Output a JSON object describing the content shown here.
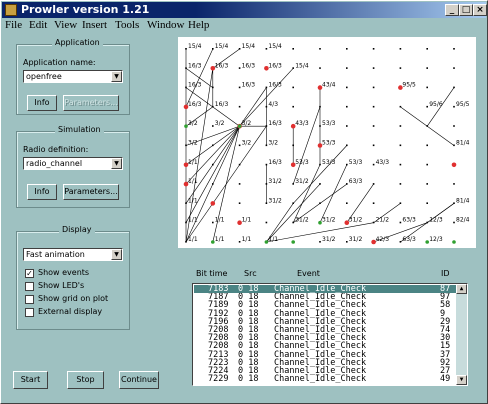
{
  "window": {
    "title": "Prowler version 1.21",
    "minimize": "_",
    "maximize": "□",
    "close": "×"
  },
  "menu": [
    "File",
    "Edit",
    "View",
    "Insert",
    "Tools",
    "Window",
    "Help"
  ],
  "application": {
    "group_title": "Application",
    "name_label": "Application name:",
    "name_value": "openfree",
    "info_button": "Info",
    "parameters_button": "Parameters..."
  },
  "simulation": {
    "group_title": "Simulation",
    "radio_label": "Radio definition:",
    "radio_value": "radio_channel",
    "info_button": "Info",
    "parameters_button": "Parameters..."
  },
  "display": {
    "group_title": "Display",
    "mode_value": "Fast animation",
    "checkboxes": [
      {
        "label": "Show events",
        "checked": true
      },
      {
        "label": "Show LED's",
        "checked": false
      },
      {
        "label": "Show grid on plot",
        "checked": false
      },
      {
        "label": "External display",
        "checked": false
      }
    ]
  },
  "buttons": {
    "start": "Start",
    "stop": "Stop",
    "continue": "Continue"
  },
  "plot": {
    "node_labels": [
      {
        "t": "15/4",
        "c": 0,
        "r": 0
      },
      {
        "t": "15/4",
        "c": 1,
        "r": 0
      },
      {
        "t": "15/4",
        "c": 2,
        "r": 0
      },
      {
        "t": "15/4",
        "c": 3,
        "r": 0
      },
      {
        "t": "16/3",
        "c": 0,
        "r": 1
      },
      {
        "t": "16/3",
        "c": 1,
        "r": 1
      },
      {
        "t": "16/3",
        "c": 2,
        "r": 1
      },
      {
        "t": "16/3",
        "c": 3,
        "r": 1
      },
      {
        "t": "15/4",
        "c": 4,
        "r": 1
      },
      {
        "t": "16/3",
        "c": 0,
        "r": 2
      },
      {
        "t": "16/3",
        "c": 2,
        "r": 2
      },
      {
        "t": "16/3",
        "c": 3,
        "r": 2
      },
      {
        "t": "43/4",
        "c": 5,
        "r": 2
      },
      {
        "t": "95/5",
        "c": 8,
        "r": 2
      },
      {
        "t": "16/3",
        "c": 0,
        "r": 3
      },
      {
        "t": "16/3",
        "c": 1,
        "r": 3
      },
      {
        "t": "4/3",
        "c": 3,
        "r": 3
      },
      {
        "t": "95/6",
        "c": 9,
        "r": 3
      },
      {
        "t": "95/5",
        "c": 10,
        "r": 3
      },
      {
        "t": "3/2",
        "c": 0,
        "r": 4
      },
      {
        "t": "3/2",
        "c": 1,
        "r": 4
      },
      {
        "t": "3/2",
        "c": 2,
        "r": 4
      },
      {
        "t": "16/3",
        "c": 3,
        "r": 4
      },
      {
        "t": "43/3",
        "c": 4,
        "r": 4
      },
      {
        "t": "53/3",
        "c": 5,
        "r": 4
      },
      {
        "t": "3/2",
        "c": 0,
        "r": 5
      },
      {
        "t": "3/2",
        "c": 2,
        "r": 5
      },
      {
        "t": "3/2",
        "c": 3,
        "r": 5
      },
      {
        "t": "53/3",
        "c": 5,
        "r": 5
      },
      {
        "t": "81/4",
        "c": 10,
        "r": 5
      },
      {
        "t": "1/1",
        "c": 0,
        "r": 6
      },
      {
        "t": "16/3",
        "c": 3,
        "r": 6
      },
      {
        "t": "53/3",
        "c": 4,
        "r": 6
      },
      {
        "t": "53/3",
        "c": 5,
        "r": 6
      },
      {
        "t": "53/3",
        "c": 6,
        "r": 6
      },
      {
        "t": "43/3",
        "c": 7,
        "r": 6
      },
      {
        "t": "1/1",
        "c": 0,
        "r": 7
      },
      {
        "t": "31/2",
        "c": 3,
        "r": 7
      },
      {
        "t": "31/2",
        "c": 4,
        "r": 7
      },
      {
        "t": "63/3",
        "c": 6,
        "r": 7
      },
      {
        "t": "1/1",
        "c": 0,
        "r": 8
      },
      {
        "t": "31/2",
        "c": 3,
        "r": 8
      },
      {
        "t": "81/4",
        "c": 10,
        "r": 8
      },
      {
        "t": "1/1",
        "c": 0,
        "r": 9
      },
      {
        "t": "1/1",
        "c": 1,
        "r": 9
      },
      {
        "t": "1/1",
        "c": 2,
        "r": 9
      },
      {
        "t": "31/2",
        "c": 4,
        "r": 9
      },
      {
        "t": "31/2",
        "c": 5,
        "r": 9
      },
      {
        "t": "31/2",
        "c": 6,
        "r": 9
      },
      {
        "t": "21/2",
        "c": 7,
        "r": 9
      },
      {
        "t": "63/3",
        "c": 8,
        "r": 9
      },
      {
        "t": "12/3",
        "c": 9,
        "r": 9
      },
      {
        "t": "82/4",
        "c": 10,
        "r": 9
      },
      {
        "t": "1/1",
        "c": 0,
        "r": 10
      },
      {
        "t": "1/1",
        "c": 1,
        "r": 10
      },
      {
        "t": "1/1",
        "c": 2,
        "r": 10
      },
      {
        "t": "1/1",
        "c": 3,
        "r": 10
      },
      {
        "t": "31/2",
        "c": 5,
        "r": 10
      },
      {
        "t": "31/2",
        "c": 6,
        "r": 10
      },
      {
        "t": "42/3",
        "c": 7,
        "r": 10
      },
      {
        "t": "63/3",
        "c": 8,
        "r": 10
      },
      {
        "t": "12/3",
        "c": 9,
        "r": 10
      }
    ]
  },
  "events": {
    "headers": {
      "bit": "Bit time",
      "src": "Src",
      "event": "Event",
      "id": "ID"
    },
    "rows": [
      {
        "bit": "7183",
        "src": "0 18",
        "event": "Channel_Idle_Check",
        "id": "87"
      },
      {
        "bit": "7187",
        "src": "0 18",
        "event": "Channel_Idle_Check",
        "id": "97"
      },
      {
        "bit": "7189",
        "src": "0 18",
        "event": "Channel_Idle_Check",
        "id": "58"
      },
      {
        "bit": "7192",
        "src": "0 18",
        "event": "Channel_Idle_Check",
        "id": "9"
      },
      {
        "bit": "7196",
        "src": "0 18",
        "event": "Channel_Idle_Check",
        "id": "29"
      },
      {
        "bit": "7208",
        "src": "0 18",
        "event": "Channel_Idle_Check",
        "id": "74"
      },
      {
        "bit": "7208",
        "src": "0 18",
        "event": "Channel_Idle_Check",
        "id": "30"
      },
      {
        "bit": "7208",
        "src": "0 18",
        "event": "Channel_Idle_Check",
        "id": "15"
      },
      {
        "bit": "7213",
        "src": "0 18",
        "event": "Channel_Idle_Check",
        "id": "37"
      },
      {
        "bit": "7223",
        "src": "0 18",
        "event": "Channel_Idle_Check",
        "id": "92"
      },
      {
        "bit": "7224",
        "src": "0 18",
        "event": "Channel_Idle_Check",
        "id": "27"
      },
      {
        "bit": "7229",
        "src": "0 18",
        "event": "Channel_Idle_Check",
        "id": "49"
      }
    ]
  }
}
